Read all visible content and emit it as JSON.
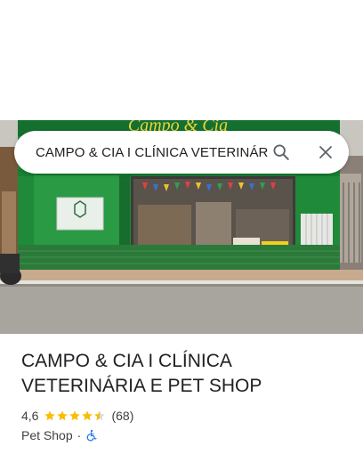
{
  "search": {
    "value": "CAMPO & CIA I CLÍNICA VETERINÁR"
  },
  "place": {
    "title": "CAMPO & CIA I CLÍNICA VETERINÁRIA E PET SHOP",
    "rating": "4,6",
    "rating_value": 4.6,
    "reviews": "(68)",
    "category": "Pet Shop",
    "separator": "·"
  },
  "photo": {
    "sign_text": "Campo & Cia"
  },
  "colors": {
    "star": "#fbbc04",
    "accessible_icon": "#1a73e8",
    "storefront_green": "#1f8a3a"
  },
  "icons": {
    "search": "magnifier",
    "close": "x",
    "accessibility": "wheelchair"
  }
}
